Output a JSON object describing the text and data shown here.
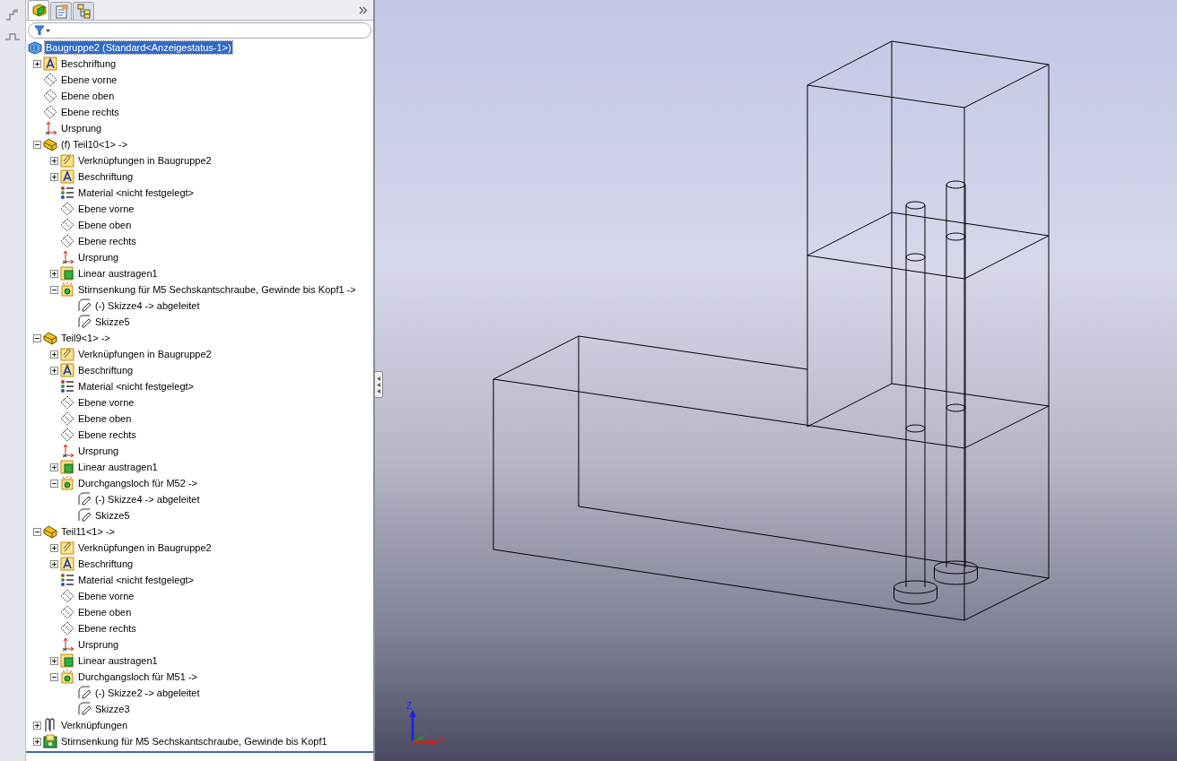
{
  "panel_tabs": [
    {
      "kind": "feature",
      "selected": true
    },
    {
      "kind": "property",
      "selected": false
    },
    {
      "kind": "config",
      "selected": false
    }
  ],
  "tree": [
    {
      "label": "Baugruppe2  (Standard<Anzeigestatus-1>)",
      "kind": "assembly",
      "selected": true,
      "children": [
        {
          "label": "Beschriftung",
          "kind": "annotation",
          "selected": false,
          "expanded": false
        },
        {
          "label": "Ebene vorne",
          "kind": "plane",
          "selected": false
        },
        {
          "label": "Ebene oben",
          "kind": "plane",
          "selected": false
        },
        {
          "label": "Ebene rechts",
          "kind": "plane",
          "selected": false
        },
        {
          "label": "Ursprung",
          "kind": "origin",
          "selected": false
        },
        {
          "label": "(f) Teil10<1> ->",
          "kind": "part",
          "selected": false,
          "expanded": true,
          "children": [
            {
              "label": "Verknüpfungen in Baugruppe2",
              "kind": "matefolder",
              "selected": false,
              "expanded": false
            },
            {
              "label": "Beschriftung",
              "kind": "annotation",
              "selected": false,
              "expanded": false
            },
            {
              "label": "Material <nicht festgelegt>",
              "kind": "material",
              "selected": false
            },
            {
              "label": "Ebene vorne",
              "kind": "plane",
              "selected": false
            },
            {
              "label": "Ebene oben",
              "kind": "plane",
              "selected": false
            },
            {
              "label": "Ebene rechts",
              "kind": "plane",
              "selected": false
            },
            {
              "label": "Ursprung",
              "kind": "origin",
              "selected": false
            },
            {
              "label": "Linear austragen1",
              "kind": "extrude",
              "selected": false,
              "expanded": false
            },
            {
              "label": "Stirnsenkung für M5 Sechskantschraube, Gewinde bis Kopf1 ->",
              "kind": "hole",
              "selected": false,
              "expanded": true,
              "children": [
                {
                  "label": "(-) Skizze4 -> abgeleitet",
                  "kind": "sketch",
                  "selected": false
                },
                {
                  "label": "Skizze5",
                  "kind": "sketch",
                  "selected": false
                }
              ]
            }
          ]
        },
        {
          "label": "Teil9<1> ->",
          "kind": "part",
          "selected": false,
          "expanded": true,
          "children": [
            {
              "label": "Verknüpfungen in Baugruppe2",
              "kind": "matefolder",
              "selected": false,
              "expanded": false
            },
            {
              "label": "Beschriftung",
              "kind": "annotation",
              "selected": false,
              "expanded": false
            },
            {
              "label": "Material <nicht festgelegt>",
              "kind": "material",
              "selected": false
            },
            {
              "label": "Ebene vorne",
              "kind": "plane",
              "selected": false
            },
            {
              "label": "Ebene oben",
              "kind": "plane",
              "selected": false
            },
            {
              "label": "Ebene rechts",
              "kind": "plane",
              "selected": false
            },
            {
              "label": "Ursprung",
              "kind": "origin",
              "selected": false
            },
            {
              "label": "Linear austragen1",
              "kind": "extrude",
              "selected": false,
              "expanded": false
            },
            {
              "label": "Durchgangsloch für M52 ->",
              "kind": "hole",
              "selected": false,
              "expanded": true,
              "children": [
                {
                  "label": "(-) Skizze4 -> abgeleitet",
                  "kind": "sketch",
                  "selected": false
                },
                {
                  "label": "Skizze5",
                  "kind": "sketch",
                  "selected": false
                }
              ]
            }
          ]
        },
        {
          "label": "Teil11<1> ->",
          "kind": "part",
          "selected": false,
          "expanded": true,
          "children": [
            {
              "label": "Verknüpfungen in Baugruppe2",
              "kind": "matefolder",
              "selected": false,
              "expanded": false
            },
            {
              "label": "Beschriftung",
              "kind": "annotation",
              "selected": false,
              "expanded": false
            },
            {
              "label": "Material <nicht festgelegt>",
              "kind": "material",
              "selected": false
            },
            {
              "label": "Ebene vorne",
              "kind": "plane",
              "selected": false
            },
            {
              "label": "Ebene oben",
              "kind": "plane",
              "selected": false
            },
            {
              "label": "Ebene rechts",
              "kind": "plane",
              "selected": false
            },
            {
              "label": "Ursprung",
              "kind": "origin",
              "selected": false
            },
            {
              "label": "Linear austragen1",
              "kind": "extrude",
              "selected": false,
              "expanded": false
            },
            {
              "label": "Durchgangsloch für M51 ->",
              "kind": "hole",
              "selected": false,
              "expanded": true,
              "children": [
                {
                  "label": "(-) Skizze2 -> abgeleitet",
                  "kind": "sketch",
                  "selected": false
                },
                {
                  "label": "Skizze3",
                  "kind": "sketch",
                  "selected": false
                }
              ]
            }
          ]
        },
        {
          "label": "Verknüpfungen",
          "kind": "mates",
          "selected": false,
          "expanded": false
        },
        {
          "label": "Stirnsenkung für M5 Sechskantschraube, Gewinde bis Kopf1",
          "kind": "holeseries",
          "selected": false,
          "expanded": false
        }
      ]
    }
  ],
  "triad": {
    "z": "Z",
    "y": "Y",
    "x": "X"
  }
}
